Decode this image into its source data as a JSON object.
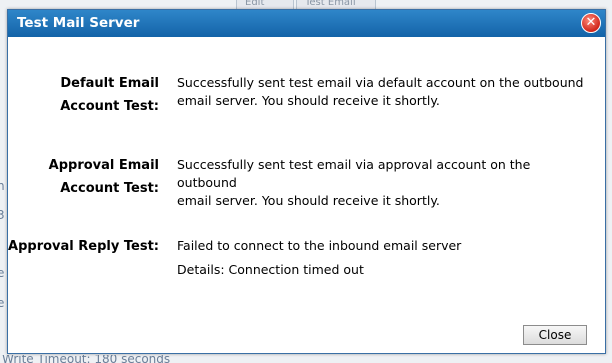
{
  "background": {
    "edit_button": "Edit",
    "test_email_button": "Test Email",
    "side_fragments": [
      "n",
      "3",
      "e",
      "e"
    ],
    "footer_fragment": "Write Timeout:     180 seconds"
  },
  "dialog": {
    "title": "Test Mail Server",
    "close_icon": "close-icon",
    "rows": [
      {
        "label_line1": "Default Email",
        "label_line2": "Account Test:",
        "value_line1": "Successfully sent test email via default account on the outbound",
        "value_line2": "email server. You should receive it shortly."
      },
      {
        "label_line1": "Approval Email",
        "label_line2": "Account Test:",
        "value_line1": "Successfully sent test email via approval account on the outbound",
        "value_line2": "email server. You should receive it shortly."
      },
      {
        "label_line1": "Approval Reply Test:",
        "value_line1": "Failed to connect to the inbound email server",
        "value_line2": "Details: Connection timed out"
      }
    ],
    "close_button_label": "Close"
  }
}
